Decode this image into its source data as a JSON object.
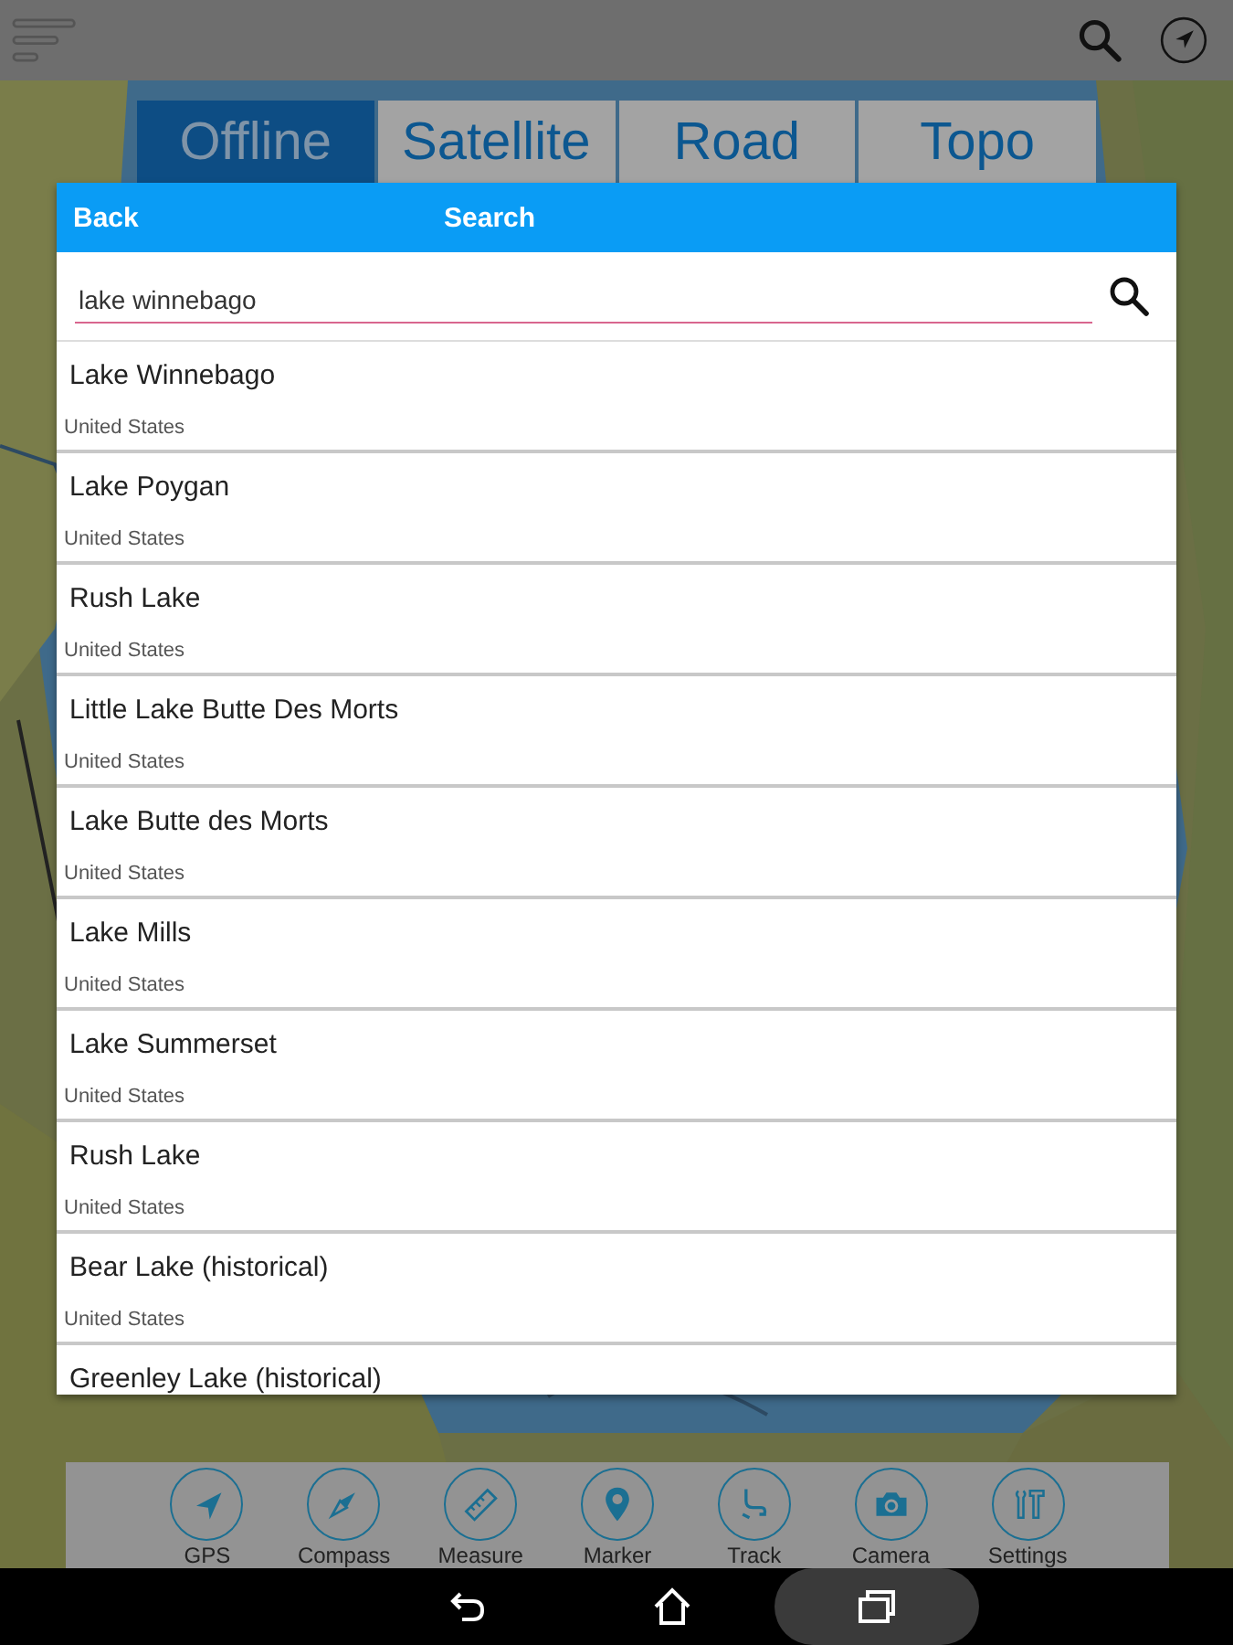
{
  "map_tabs": [
    {
      "label": "Offline",
      "selected": true
    },
    {
      "label": "Satellite",
      "selected": false
    },
    {
      "label": "Road",
      "selected": false
    },
    {
      "label": "Topo",
      "selected": false
    }
  ],
  "search_dialog": {
    "back": "Back",
    "title": "Search",
    "query": "lake winnebago",
    "results": [
      {
        "name": "Lake Winnebago",
        "country": "United States"
      },
      {
        "name": "Lake Poygan",
        "country": "United States"
      },
      {
        "name": "Rush Lake",
        "country": "United States"
      },
      {
        "name": "Little Lake Butte Des Morts",
        "country": "United States"
      },
      {
        "name": "Lake Butte des Morts",
        "country": "United States"
      },
      {
        "name": "Lake Mills",
        "country": "United States"
      },
      {
        "name": "Lake Summerset",
        "country": "United States"
      },
      {
        "name": "Rush Lake",
        "country": "United States"
      },
      {
        "name": "Bear Lake (historical)",
        "country": "United States"
      },
      {
        "name": "Greenley Lake (historical)"
      }
    ]
  },
  "toolbar": [
    {
      "kind": "gps",
      "label": "GPS"
    },
    {
      "kind": "compass",
      "label": "Compass"
    },
    {
      "kind": "measure",
      "label": "Measure"
    },
    {
      "kind": "marker",
      "label": "Marker"
    },
    {
      "kind": "track",
      "label": "Track"
    },
    {
      "kind": "camera",
      "label": "Camera"
    },
    {
      "kind": "settings",
      "label": "Settings"
    }
  ]
}
